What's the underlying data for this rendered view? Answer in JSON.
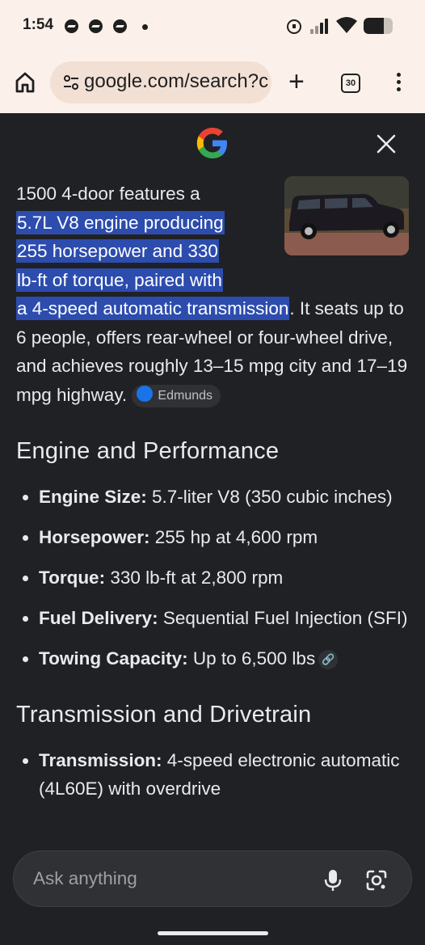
{
  "status_bar": {
    "time": "1:54",
    "battery_level": 0.7
  },
  "browser": {
    "url": "google.com/search?c",
    "tab_count": "30"
  },
  "answer": {
    "lead": "1500 4-door features a",
    "highlight_lines": [
      "5.7L V8 engine producing",
      "255 horsepower and 330",
      "lb-ft of torque, paired with",
      "a 4-speed automatic transmission"
    ],
    "rest": ". It seats up to 6 people, offers rear-wheel or four-wheel drive, and achieves roughly 13–15 mpg city and 17–19 mpg highway.",
    "source": "Edmunds"
  },
  "sections": [
    {
      "heading": "Engine and Performance",
      "items": [
        {
          "label": "Engine Size:",
          "value": " 5.7-liter V8 (350 cubic inches)"
        },
        {
          "label": "Horsepower:",
          "value": " 255 hp at 4,600 rpm"
        },
        {
          "label": "Torque:",
          "value": " 330 lb-ft at 2,800 rpm"
        },
        {
          "label": "Fuel Delivery:",
          "value": " Sequential Fuel Injection (SFI)"
        },
        {
          "label": "Towing Capacity:",
          "value": " Up to 6,500 lbs"
        }
      ]
    },
    {
      "heading": "Transmission and Drivetrain",
      "items": [
        {
          "label": "Transmission:",
          "value": " 4-speed electronic automatic (4L60E) with overdrive"
        }
      ]
    }
  ],
  "ask_bar": {
    "placeholder": "Ask anything"
  },
  "colors": {
    "highlight": "#2c4cae",
    "background": "#202124",
    "chrome": "#fbf1ea"
  },
  "icons": [
    "home-icon",
    "tune-icon",
    "plus-icon",
    "tab-switcher-icon",
    "more-vert-icon",
    "google-g-logo",
    "close-icon",
    "link-icon",
    "mic-icon",
    "lens-icon"
  ]
}
